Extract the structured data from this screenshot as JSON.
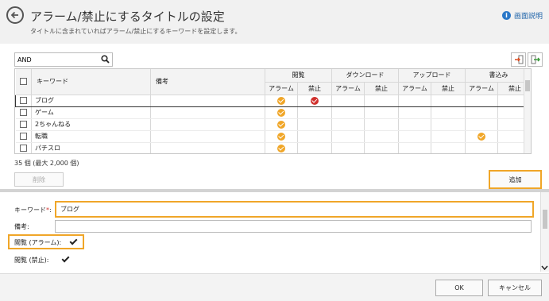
{
  "header": {
    "title": "アラーム/禁止にするタイトルの設定",
    "subtitle": "タイトルに含まれていればアラーム/禁止にするキーワードを設定します。",
    "help_label": "画面説明"
  },
  "search": {
    "value": "AND"
  },
  "table": {
    "col_keyword": "キーワード",
    "col_note": "備考",
    "groups": [
      "閲覧",
      "ダウンロード",
      "アップロード",
      "書込み"
    ],
    "sub_alarm": "アラーム",
    "sub_block": "禁止",
    "rows": [
      {
        "keyword": "ブログ",
        "marks": [
          "ok",
          "ng",
          "",
          "",
          "",
          "",
          "",
          ""
        ]
      },
      {
        "keyword": "ゲーム",
        "marks": [
          "ok",
          "",
          "",
          "",
          "",
          "",
          "",
          ""
        ]
      },
      {
        "keyword": "2ちゃんねる",
        "marks": [
          "ok",
          "",
          "",
          "",
          "",
          "",
          "",
          ""
        ]
      },
      {
        "keyword": "転職",
        "marks": [
          "ok",
          "",
          "",
          "",
          "",
          "",
          "ok",
          ""
        ]
      },
      {
        "keyword": "パチスロ",
        "marks": [
          "ok",
          "",
          "",
          "",
          "",
          "",
          "",
          ""
        ]
      }
    ]
  },
  "count_text": "35 個 (最大 2,000 個)",
  "buttons": {
    "delete": "削除",
    "add": "追加",
    "ok": "OK",
    "cancel": "キャンセル"
  },
  "form": {
    "keyword_label": "キーワード",
    "required_mark": "*",
    "keyword_colon": ":",
    "keyword_value": "ブログ",
    "note_label": "備考:",
    "note_value": "",
    "view_alarm_label": "閲覧 (アラーム):",
    "view_block_label": "閲覧 (禁止):",
    "view_alarm_checked": true,
    "view_block_checked": true
  },
  "colors": {
    "accent": "#f0a628",
    "ng": "#d0312d",
    "link": "#2266aa"
  }
}
